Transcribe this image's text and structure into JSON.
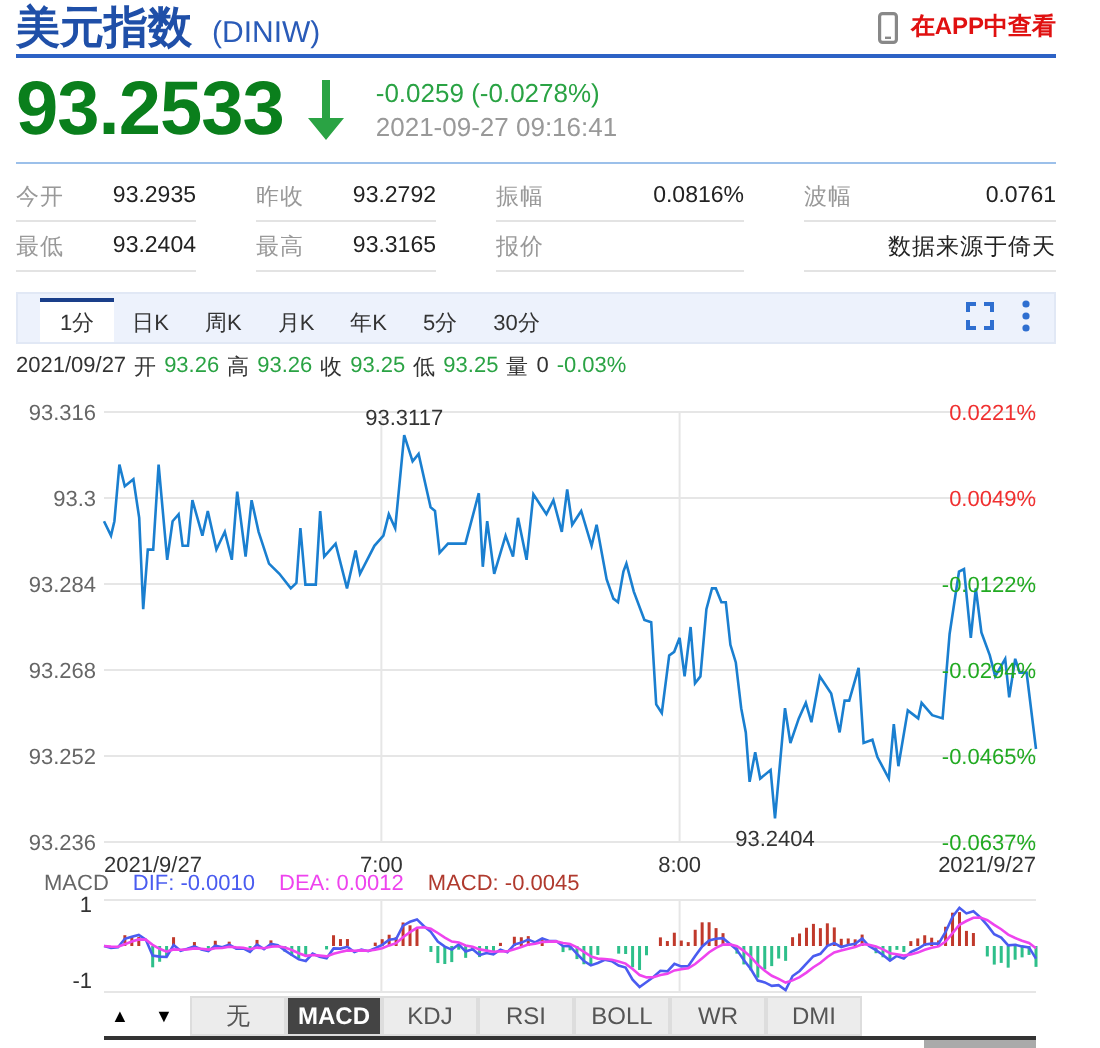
{
  "header": {
    "title": "美元指数",
    "code": "(DINIW)",
    "app_link": "在APP中查看"
  },
  "quote": {
    "price": "93.2533",
    "falling": true,
    "change": "-0.0259 (-0.0278%)",
    "time": "2021-09-27 09:16:41"
  },
  "stats": [
    {
      "label": "今开",
      "value": "93.2935"
    },
    {
      "label": "昨收",
      "value": "93.2792"
    },
    {
      "label": "振幅",
      "value": "0.0816%"
    },
    {
      "label": "波幅",
      "value": "0.0761"
    },
    {
      "label": "最低",
      "value": "93.2404"
    },
    {
      "label": "最高",
      "value": "93.3165"
    },
    {
      "label": "报价"
    },
    {
      "value": "数据来源于倚天"
    }
  ],
  "period_tabs": [
    {
      "label": "1分",
      "selected": true
    },
    {
      "label": "日K",
      "selected": false
    },
    {
      "label": "周K",
      "selected": false
    },
    {
      "label": "月K",
      "selected": false
    },
    {
      "label": "年K",
      "selected": false
    },
    {
      "label": "5分",
      "selected": false
    },
    {
      "label": "30分",
      "selected": false
    }
  ],
  "bar_info": {
    "date": "2021/09/27",
    "fields": [
      {
        "label": "开",
        "value": "93.26",
        "kind": "price"
      },
      {
        "label": "高",
        "value": "93.26",
        "kind": "price"
      },
      {
        "label": "收",
        "value": "93.25",
        "kind": "price"
      },
      {
        "label": "低",
        "value": "93.25",
        "kind": "price"
      },
      {
        "label": "量",
        "value": "0",
        "kind": "volume"
      }
    ],
    "change": "-0.03%"
  },
  "chart": {
    "chart_data": {
      "type": "line",
      "grid": true,
      "xlim": [
        364.2,
        551.7
      ],
      "ylim": [
        93.236,
        93.316
      ],
      "yticks": [
        93.236,
        93.252,
        93.268,
        93.284,
        93.3,
        93.316
      ],
      "xticks": [
        {
          "value": 364.2,
          "label": "2021/9/27"
        },
        {
          "value": 420,
          "label": "7:00"
        },
        {
          "value": 480,
          "label": "8:00"
        },
        {
          "value": 551.7,
          "label": "2021/9/27"
        }
      ],
      "x": [
        364.2,
        365.6,
        366.3,
        367.3,
        368.4,
        370.1,
        371.3,
        372.1,
        373.0,
        374.1,
        375.2,
        376.9,
        378.0,
        379.2,
        380.0,
        381.1,
        382.0,
        384.0,
        385.1,
        386.8,
        388.5,
        389.9,
        391.0,
        392.7,
        393.9,
        395.3,
        397.4,
        399.5,
        401.8,
        402.9,
        403.7,
        404.7,
        406.8,
        407.7,
        408.5,
        410.8,
        413.1,
        414.8,
        415.7,
        418.6,
        420.4,
        421.5,
        422.8,
        424.6,
        426.3,
        427.5,
        429.9,
        430.8,
        431.7,
        433.4,
        436.9,
        439.6,
        440.4,
        441.3,
        442.7,
        445.0,
        446.5,
        447.5,
        449.2,
        450.6,
        453.2,
        454.6,
        456.3,
        457.4,
        458.4,
        460.2,
        462.3,
        463.3,
        465.3,
        466.7,
        467.6,
        468.7,
        469.3,
        470.8,
        472.9,
        474.3,
        475.3,
        476.4,
        477.9,
        478.9,
        480.0,
        481.0,
        482.2,
        483.1,
        484.2,
        485.4,
        486.5,
        487.3,
        488.4,
        489.3,
        490.2,
        491.3,
        492.4,
        493.3,
        494.1,
        495.2,
        496.2,
        498.3,
        499.2,
        501.2,
        502.3,
        504.0,
        505.4,
        506.5,
        508.2,
        510.5,
        512.2,
        513.2,
        514.1,
        516.0,
        517.0,
        518.8,
        519.8,
        522.1,
        523.1,
        524.0,
        525.9,
        528.0,
        528.7,
        530.8,
        532.9,
        534.3,
        536.2,
        537.2,
        538.6,
        539.6,
        540.7,
        542.4,
        543.5,
        545.5,
        546.3,
        547.5,
        548.4,
        549.8,
        551.7
      ],
      "series": [
        {
          "color": "#1a7fd0",
          "values": [
            93.2957,
            93.293,
            93.2957,
            93.3062,
            93.3022,
            93.3035,
            93.2963,
            93.2793,
            93.2904,
            93.2904,
            93.3062,
            93.2885,
            93.2957,
            93.297,
            93.2911,
            93.2911,
            93.2996,
            93.293,
            93.2976,
            93.2904,
            93.2937,
            93.2885,
            93.3012,
            93.2891,
            93.2996,
            93.2937,
            93.2878,
            93.2859,
            93.2832,
            93.2842,
            93.2944,
            93.2839,
            93.2839,
            93.2976,
            93.2891,
            93.2915,
            93.2832,
            93.2902,
            93.2859,
            93.2911,
            93.293,
            93.297,
            93.2944,
            93.3117,
            93.3068,
            93.3082,
            93.2983,
            93.2976,
            93.2898,
            93.2915,
            93.2915,
            93.3009,
            93.2872,
            93.2957,
            93.2859,
            93.293,
            93.2891,
            93.2963,
            93.2885,
            93.3007,
            93.297,
            93.2996,
            93.2937,
            93.3016,
            93.295,
            93.2976,
            93.2911,
            93.295,
            93.2849,
            93.2813,
            93.2806,
            93.2863,
            93.2878,
            93.2826,
            93.2773,
            93.2769,
            93.2616,
            93.26,
            93.2707,
            93.2714,
            93.274,
            93.2668,
            93.276,
            93.2655,
            93.2668,
            93.2793,
            93.2832,
            93.2832,
            93.2806,
            93.2806,
            93.2727,
            93.2694,
            93.2609,
            93.2564,
            93.2472,
            93.2527,
            93.2478,
            93.2494,
            93.2404,
            93.2609,
            93.2544,
            93.259,
            93.2619,
            93.2583,
            93.2668,
            93.2636,
            93.2564,
            93.2623,
            93.2623,
            93.2684,
            93.2544,
            93.255,
            93.2518,
            93.2478,
            93.2579,
            93.2501,
            93.2605,
            93.259,
            93.2619,
            93.2596,
            93.259,
            93.2747,
            93.2863,
            93.2868,
            93.274,
            93.2832,
            93.275,
            93.2707,
            93.2668,
            93.2701,
            93.2629,
            93.2701,
            93.2675,
            93.2675,
            93.2533
          ]
        }
      ],
      "annotations": [
        {
          "text": "93.3117",
          "x": 424.6,
          "y": 93.3117
        },
        {
          "text": "93.2404",
          "x": 499.2,
          "y": 93.2404
        }
      ]
    },
    "right_labels": [
      {
        "text": "0.0221%",
        "color": "#f03030"
      },
      {
        "text": "0.0049%",
        "color": "#f03030"
      },
      {
        "text": "-0.0122%",
        "color": "#22aa22"
      },
      {
        "text": "-0.0294%",
        "color": "#22aa22"
      },
      {
        "text": "-0.0465%",
        "color": "#22aa22"
      },
      {
        "text": "-0.0637%",
        "color": "#22aa22"
      }
    ]
  },
  "macd": {
    "legend": [
      {
        "text": "MACD",
        "color": "#666666"
      },
      {
        "text": "DIF: -0.0010",
        "color": "#4a5cf0"
      },
      {
        "text": "DEA: 0.0012",
        "color": "#ee44ee"
      },
      {
        "text": "MACD: -0.0045",
        "color": "#b03a2e"
      }
    ],
    "axis_labels": [
      "1",
      "-1"
    ]
  },
  "nav_buttons": [
    "▲",
    "▼"
  ],
  "indicator_tabs": [
    {
      "label": "无",
      "selected": false
    },
    {
      "label": "MACD",
      "selected": true
    },
    {
      "label": "KDJ",
      "selected": false
    },
    {
      "label": "RSI",
      "selected": false
    },
    {
      "label": "BOLL",
      "selected": false
    },
    {
      "label": "WR",
      "selected": false
    },
    {
      "label": "DMI",
      "selected": false
    }
  ]
}
